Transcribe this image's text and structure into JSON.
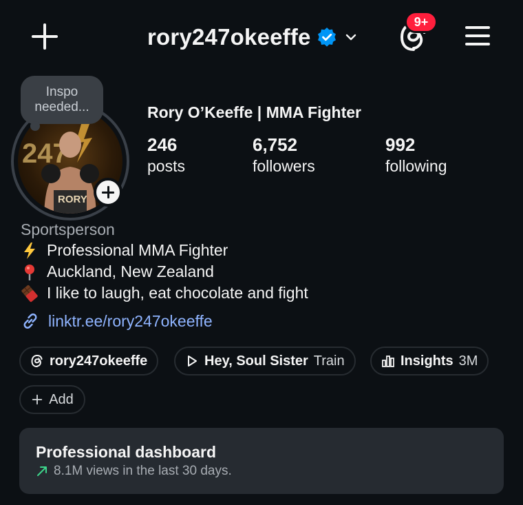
{
  "header": {
    "username": "rory247okeeffe",
    "notification_badge": "9+",
    "icons": {
      "create": "plus-icon",
      "verified": "verified-badge-icon",
      "switch": "chevron-down-icon",
      "threads": "threads-icon",
      "menu": "hamburger-menu-icon"
    }
  },
  "note": {
    "text": "Inspo needed..."
  },
  "profile": {
    "display_name": "Rory O’Keeffe | MMA Fighter",
    "avatar_text": "RORY",
    "avatar_number": "247",
    "stats": [
      {
        "value": "246",
        "label": "posts"
      },
      {
        "value": "6,752",
        "label": "followers"
      },
      {
        "value": "992",
        "label": "following"
      }
    ]
  },
  "bio": {
    "category": "Sportsperson",
    "lines": [
      {
        "icon": "lightning-emoji",
        "text": "Professional MMA Fighter"
      },
      {
        "icon": "pin-emoji",
        "text": "Auckland, New Zealand"
      },
      {
        "icon": "chocolate-emoji",
        "text": "I like to laugh, eat chocolate and fight"
      }
    ],
    "link": "linktr.ee/rory247okeeffe"
  },
  "chips": {
    "threads": {
      "label": "rory247okeeffe",
      "icon": "threads-icon"
    },
    "music": {
      "title": "Hey, Soul Sister",
      "artist": "Train",
      "icon": "play-icon"
    },
    "insights": {
      "label": "Insights",
      "value": "3M",
      "icon": "bar-chart-icon"
    },
    "add": {
      "label": "Add",
      "icon": "plus-icon"
    }
  },
  "dashboard": {
    "title": "Professional dashboard",
    "subtitle": "8.1M views in the last 30 days.",
    "trend_color": "#3dd68c"
  },
  "colors": {
    "background": "#0c1014",
    "link": "#8fb4ff",
    "badge": "#ff1f3d",
    "verified": "#0095f6"
  }
}
